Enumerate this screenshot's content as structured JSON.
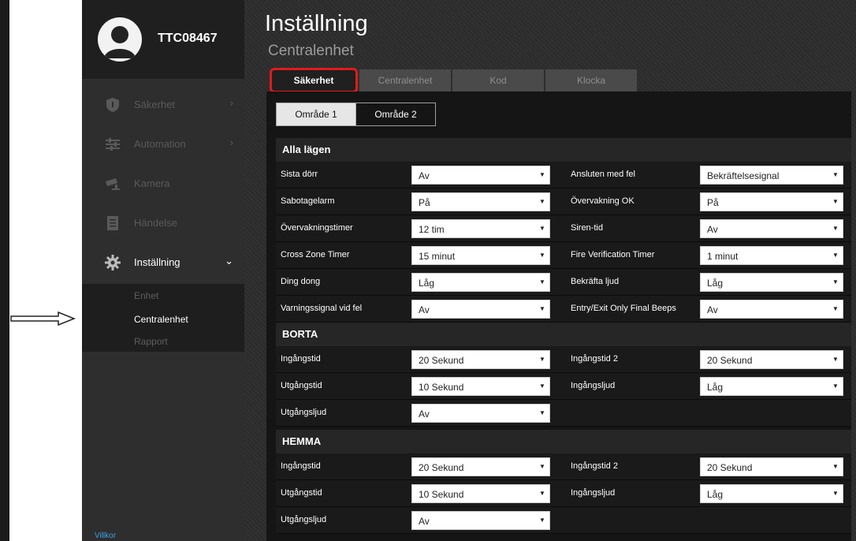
{
  "user": {
    "name": "TTC08467"
  },
  "sidebar": {
    "items": [
      {
        "label": "Säkerhet",
        "icon": "shield-icon",
        "chevron": "›"
      },
      {
        "label": "Automation",
        "icon": "sliders-icon",
        "chevron": "›"
      },
      {
        "label": "Kamera",
        "icon": "camera-icon"
      },
      {
        "label": "Händelse",
        "icon": "list-icon"
      },
      {
        "label": "Inställning",
        "icon": "gear-icon",
        "chevron": "⌄"
      }
    ],
    "submenu": [
      "Enhet",
      "Centralenhet",
      "Rapport"
    ],
    "footer": "Villkor"
  },
  "page": {
    "title": "Inställning",
    "subtitle": "Centralenhet"
  },
  "tabs": [
    "Säkerhet",
    "Centralenhet",
    "Kod",
    "Klocka"
  ],
  "areas": [
    "Område 1",
    "Område 2"
  ],
  "sections": {
    "alla": {
      "title": "Alla lägen",
      "rows": [
        {
          "left_label": "Sista dörr",
          "left_value": "Av",
          "right_label": "Ansluten med fel",
          "right_value": "Bekräftelsesignal"
        },
        {
          "left_label": "Sabotagelarm",
          "left_value": "På",
          "right_label": "Övervakning OK",
          "right_value": "På"
        },
        {
          "left_label": "Övervakningstimer",
          "left_value": "12 tim",
          "right_label": "Siren-tid",
          "right_value": "Av"
        },
        {
          "left_label": "Cross Zone Timer",
          "left_value": "15 minut",
          "right_label": "Fire Verification Timer",
          "right_value": "1 minut"
        },
        {
          "left_label": "Ding dong",
          "left_value": "Låg",
          "right_label": "Bekräfta ljud",
          "right_value": "Låg"
        },
        {
          "left_label": "Varningssignal vid fel",
          "left_value": "Av",
          "right_label": "Entry/Exit Only Final Beeps",
          "right_value": "Av"
        }
      ]
    },
    "borta": {
      "title": "BORTA",
      "rows": [
        {
          "left_label": "Ingångstid",
          "left_value": "20 Sekund",
          "right_label": "Ingångstid 2",
          "right_value": "20 Sekund"
        },
        {
          "left_label": "Utgångstid",
          "left_value": "10 Sekund",
          "right_label": "Ingångsljud",
          "right_value": "Låg"
        },
        {
          "left_label": "Utgångsljud",
          "left_value": "Av"
        }
      ]
    },
    "hemma": {
      "title": "HEMMA",
      "rows": [
        {
          "left_label": "Ingångstid",
          "left_value": "20 Sekund",
          "right_label": "Ingångstid 2",
          "right_value": "20 Sekund"
        },
        {
          "left_label": "Utgångstid",
          "left_value": "10 Sekund",
          "right_label": "Ingångsljud",
          "right_value": "Låg"
        },
        {
          "left_label": "Utgångsljud",
          "left_value": "Av"
        }
      ]
    }
  },
  "dropdown_glyph": "▼",
  "colors": {
    "tab_highlight": "#e11b1b",
    "link": "#3aa0e8",
    "sidebar": "#2e2e2e"
  }
}
